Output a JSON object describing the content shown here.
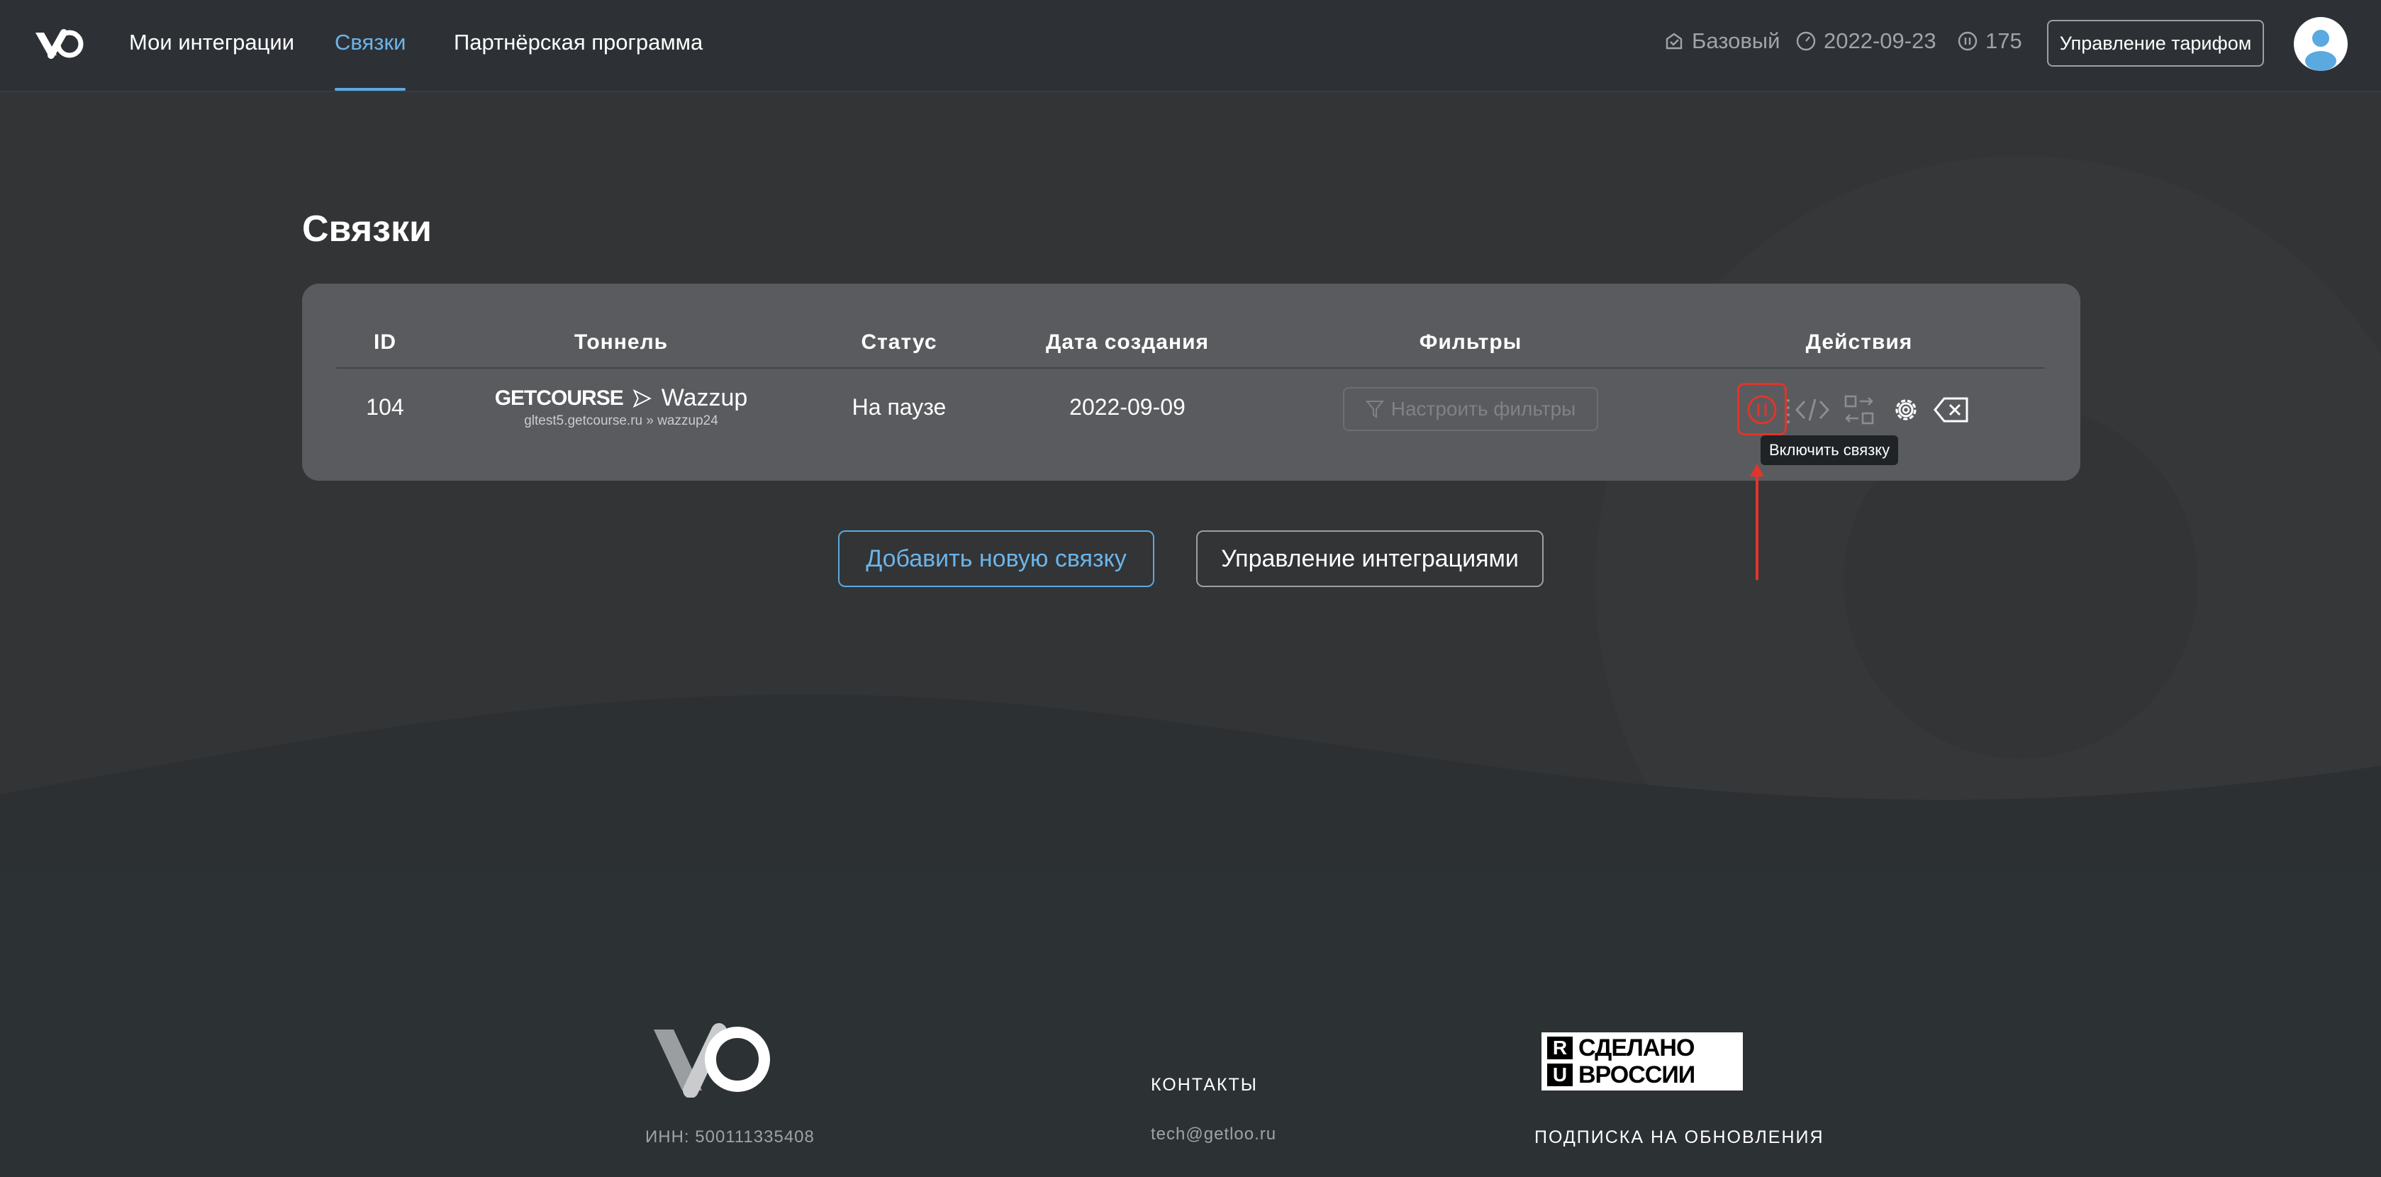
{
  "nav": {
    "items": [
      {
        "label": "Мои интеграции",
        "active": false
      },
      {
        "label": "Связки",
        "active": true
      },
      {
        "label": "Партнёрская программа",
        "active": false
      }
    ]
  },
  "account": {
    "plan": "Базовый",
    "expires": "2022-09-23",
    "balance": "175",
    "manage_plan_label": "Управление тарифом"
  },
  "page": {
    "title": "Связки"
  },
  "table": {
    "headers": [
      "ID",
      "Тоннель",
      "Статус",
      "Дата создания",
      "Фильтры",
      "Действия"
    ],
    "rows": [
      {
        "id": "104",
        "tunnel_from": "GETCOURSE",
        "tunnel_to": "Wazzup",
        "tunnel_sub": "gltest5.getcourse.ru » wazzup24",
        "status": "На паузе",
        "created": "2022-09-09",
        "filter_label": "Настроить фильтры"
      }
    ]
  },
  "tooltip": "Включить связку",
  "buttons": {
    "add": "Добавить новую связку",
    "manage": "Управление интеграциями"
  },
  "footer": {
    "inn": "ИНН: 500111335408",
    "contacts_label": "КОНТАКТЫ",
    "email": "tech@getloo.ru",
    "badge_left_top": "R",
    "badge_left_bottom": "U",
    "badge_line1": "СДЕЛАНО",
    "badge_line2": "ВРОССИИ",
    "subscribe_label": "ПОДПИСКА НА ОБНОВЛЕНИЯ"
  },
  "colors": {
    "accent": "#5aa9e0",
    "highlight": "#e0352b",
    "card": "#5a5b5e"
  }
}
